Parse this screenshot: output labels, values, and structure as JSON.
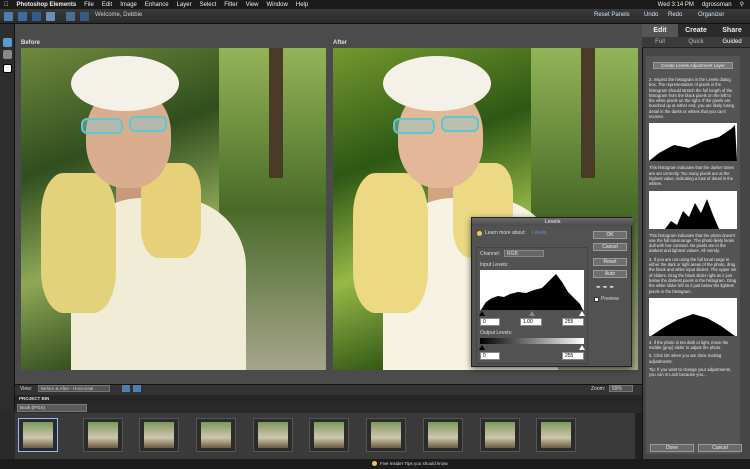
{
  "menubar": {
    "app": "Photoshop Elements",
    "items": [
      "File",
      "Edit",
      "Image",
      "Enhance",
      "Layer",
      "Select",
      "Filter",
      "View",
      "Window",
      "Help"
    ],
    "clock": "Wed 3:14 PM",
    "user": "dgrossman"
  },
  "toolbar": {
    "welcome": "Welcome, Debbie",
    "reset_panels": "Reset Panels",
    "undo": "Undo",
    "redo": "Redo",
    "organizer": "Organizer"
  },
  "canvas": {
    "before_label": "Before",
    "after_label": "After",
    "view_label": "View:",
    "view_value": "Before & After - Horizontal",
    "zoom_label": "Zoom:",
    "zoom_value": "69%"
  },
  "bin": {
    "title": "PROJECT BIN",
    "select_value": "Book (IFGS)"
  },
  "panel": {
    "tabs": [
      "Edit",
      "Create",
      "Share"
    ],
    "subtabs": [
      "Full",
      "Quick",
      "Guided"
    ],
    "create_button": "Create Levels Adjustment Layer",
    "text1": "2. Inspect the histogram in the Levels dialog box. The representation of pixels in the histogram should stretch the full length of the histogram from the black pixels on the left to the white pixels on the right. If the pixels are bunched up at either end, you are likely losing detail in the darks or whites that you can't recover.",
    "text2": "This histogram indicates that the darker tones are set correctly. Too many pixels are at the highest value, indicating a loss of detail in the whites.",
    "text3": "This histogram indicates that the photo doesn't use the full tonal range. The photo likely looks dull with low contrast. No pixels are in the darkest and lightest values. All merely.",
    "text4": "3. If you are not using the full tonal range in either the dark or light areas of the photo, drag the black and white input sliders. The upper set of sliders. Drag the black slider right as it just below the darkest pixels in the histogram. Drag the white slider left so it just below the lightest pixels in the histogram.",
    "text5": "4. If the photo is too dark or light, move the middle (gray) slider to adjust the photo.",
    "text6": "5. Click OK when you are done making adjustments.",
    "text7": "Tip: If you want to change your adjustments, you can in Lock because you...",
    "done": "Done",
    "cancel": "Cancel"
  },
  "levels": {
    "title": "Levels",
    "learn": "Learn more about:",
    "learn_link": "Levels",
    "channel_label": "Channel:",
    "channel_value": "RGB",
    "input_label": "Input Levels:",
    "input_black": "0",
    "input_mid": "1.00",
    "input_white": "255",
    "output_label": "Output Levels:",
    "output_black": "0",
    "output_white": "255",
    "ok": "OK",
    "cancel": "Cancel",
    "reset": "Reset",
    "auto": "Auto",
    "preview": "Preview"
  },
  "status": {
    "tip": "Five Insider Tips you should know."
  },
  "colors": {
    "accent": "#4f7fb0",
    "link": "#5b9be0"
  }
}
